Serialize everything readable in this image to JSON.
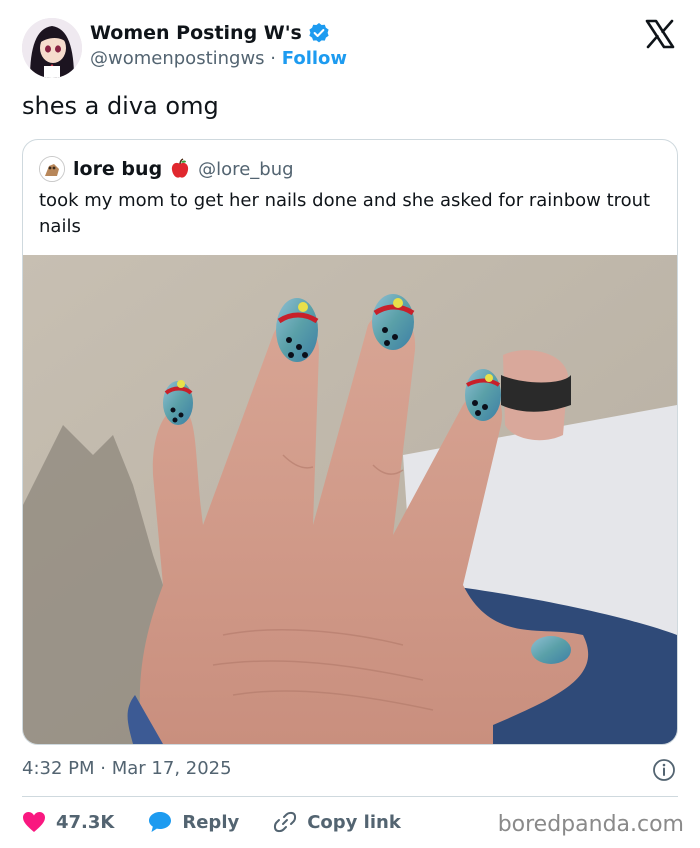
{
  "author": {
    "display_name": "Women Posting W's",
    "handle": "@womenpostingws",
    "separator": "·",
    "follow_label": "Follow"
  },
  "tweet": {
    "text": "shes a diva omg",
    "time": "4:32 PM",
    "date_separator": "·",
    "date": "Mar 17, 2025"
  },
  "quote": {
    "display_name": "lore bug",
    "handle": "@lore_bug",
    "text": "took my mom to get her nails done and she asked for rainbow trout nails"
  },
  "actions": {
    "likes": "47.3K",
    "reply_label": "Reply",
    "copy_label": "Copy link"
  },
  "watermark": "boredpanda.com",
  "colors": {
    "accent": "#1d9bf0",
    "like": "#f91880",
    "secondary_text": "#536471",
    "border": "#cfd9de"
  }
}
